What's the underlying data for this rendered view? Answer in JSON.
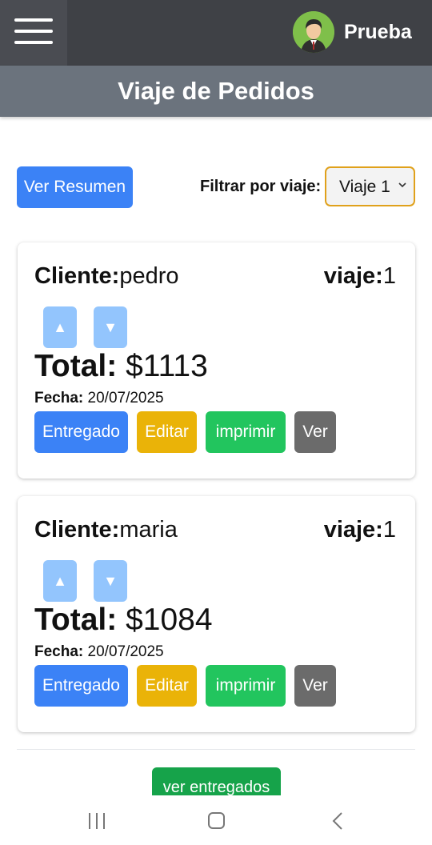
{
  "header": {
    "username": "Prueba",
    "title": "Viaje de Pedidos",
    "menu_icon": "hamburger-menu-icon",
    "avatar_icon": "user-avatar"
  },
  "toolbar": {
    "summary_button": "Ver Resumen",
    "filter_label": "Filtrar por viaje:",
    "filter_value": "Viaje 1"
  },
  "orders": [
    {
      "client_label": "Cliente:",
      "client": "pedro",
      "trip_label": "viaje:",
      "trip": "1",
      "total_label": "Total:",
      "total": "$1113",
      "date_label": "Fecha:",
      "date": "20/07/2025",
      "up": "▲",
      "down": "▼",
      "buttons": {
        "delivered": "Entregado",
        "edit": "Editar",
        "print": "imprimir",
        "view": "Ver"
      }
    },
    {
      "client_label": "Cliente:",
      "client": "maria",
      "trip_label": "viaje:",
      "trip": "1",
      "total_label": "Total:",
      "total": "$1084",
      "date_label": "Fecha:",
      "date": "20/07/2025",
      "up": "▲",
      "down": "▼",
      "buttons": {
        "delivered": "Entregado",
        "edit": "Editar",
        "print": "imprimir",
        "view": "Ver"
      }
    }
  ],
  "footer": {
    "delivered_button": "ver entregados"
  },
  "colors": {
    "topbar": "#3f4146",
    "titlebar": "#6b737d",
    "blue": "#3b82f6",
    "yellow": "#eab308",
    "green": "#22c55e",
    "gray": "#6b6b6b",
    "light_blue": "#93c5fd",
    "select_border": "#e0a11b"
  }
}
